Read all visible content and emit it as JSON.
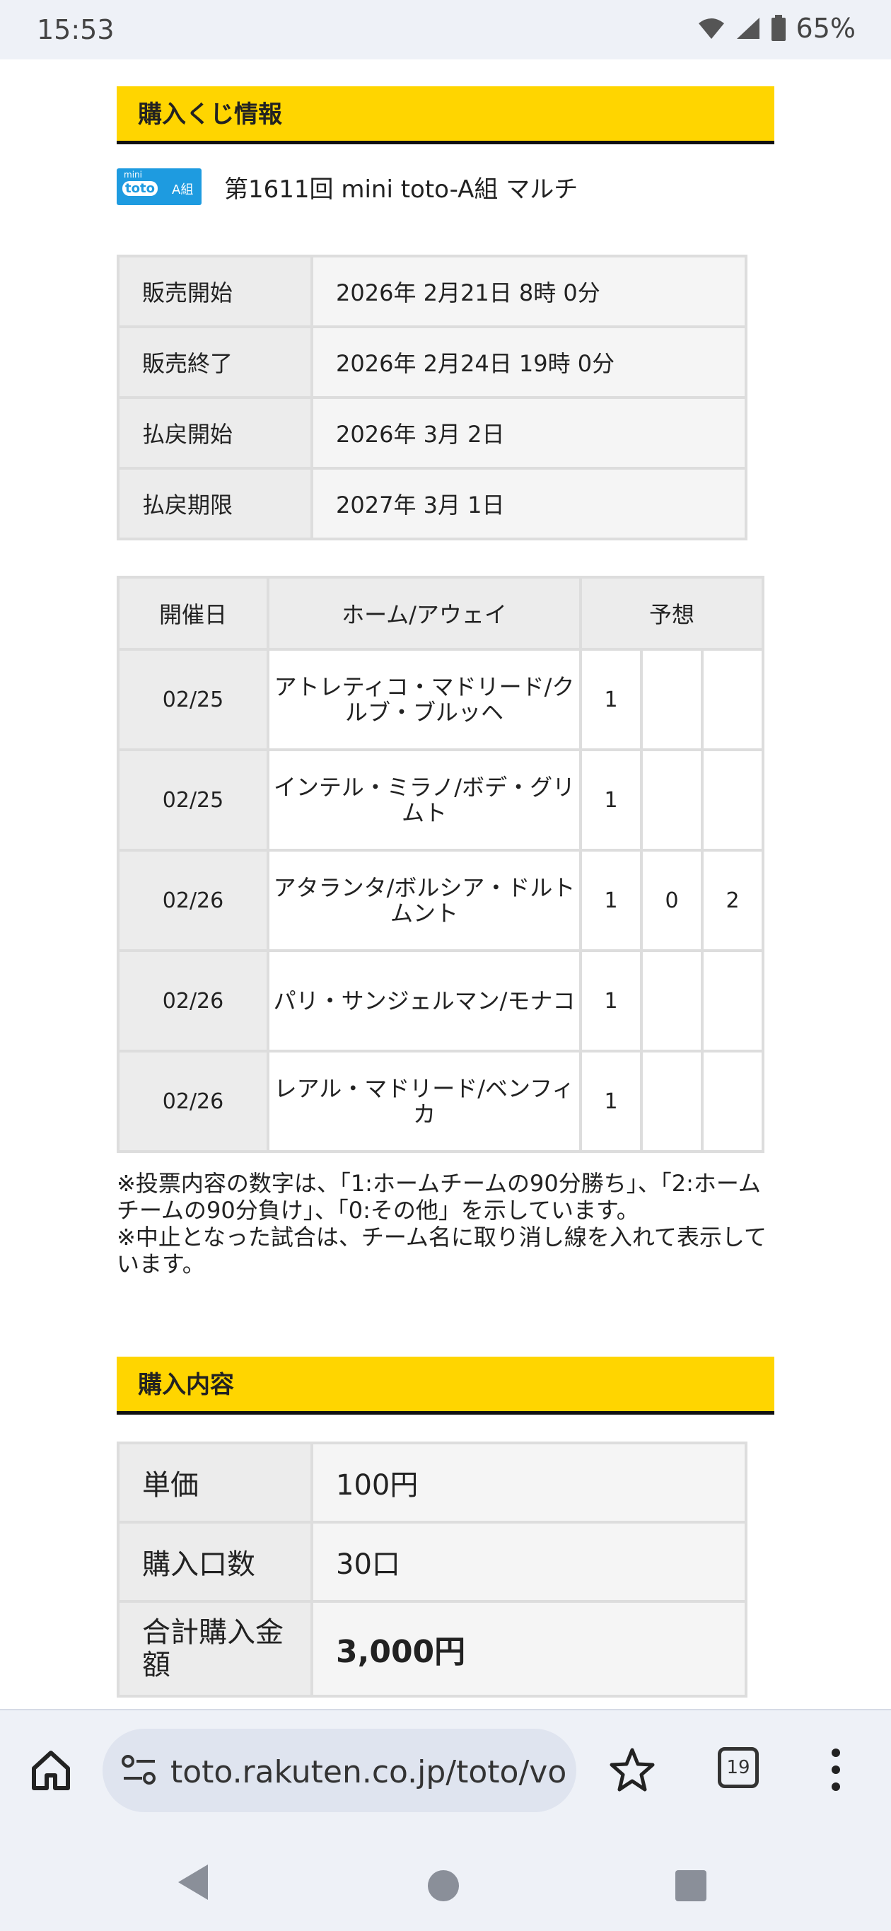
{
  "status_bar": {
    "time": "15:53",
    "battery": "65%"
  },
  "purchase_info": {
    "heading": "購入くじ情報",
    "logo_text_top": "mini",
    "logo_text_mid": "toto",
    "logo_group": "A組",
    "lottery_name": "第1611回 mini toto-A組  マルチ",
    "rows": [
      {
        "label": "販売開始",
        "value": "2026年 2月21日  8時 0分"
      },
      {
        "label": "販売終了",
        "value": "2026年 2月24日 19時 0分"
      },
      {
        "label": "払戻開始",
        "value": "2026年 3月 2日"
      },
      {
        "label": "払戻期限",
        "value": "2027年 3月 1日"
      }
    ]
  },
  "games": {
    "headers": {
      "date": "開催日",
      "teams": "ホーム/アウェイ",
      "prediction": "予想"
    },
    "rows": [
      {
        "date": "02/25",
        "teams": "アトレティコ・マドリード/クルブ・ブルッヘ",
        "p1": "1",
        "p2": "",
        "p3": ""
      },
      {
        "date": "02/25",
        "teams": "インテル・ミラノ/ボデ・グリムト",
        "p1": "1",
        "p2": "",
        "p3": ""
      },
      {
        "date": "02/26",
        "teams": "アタランタ/ボルシア・ドルトムント",
        "p1": "1",
        "p2": "0",
        "p3": "2"
      },
      {
        "date": "02/26",
        "teams": "パリ・サンジェルマン/モナコ",
        "p1": "1",
        "p2": "",
        "p3": ""
      },
      {
        "date": "02/26",
        "teams": "レアル・マドリード/ベンフィカ",
        "p1": "1",
        "p2": "",
        "p3": ""
      }
    ]
  },
  "notes": {
    "line1": "※投票内容の数字は、「1:ホームチームの90分勝ち」、「2:ホームチームの90分負け」、「0:その他」を示しています。",
    "line2": "※中止となった試合は、チーム名に取り消し線を入れて表示しています。"
  },
  "purchase_content": {
    "heading": "購入内容",
    "rows": [
      {
        "label": "単価",
        "value": "100円"
      },
      {
        "label": "購入口数",
        "value": "30口"
      },
      {
        "label": "合計購入金額",
        "value": "3,000円"
      }
    ]
  },
  "browser": {
    "url": "toto.rakuten.co.jp/toto/vo",
    "tab_count": "19"
  }
}
